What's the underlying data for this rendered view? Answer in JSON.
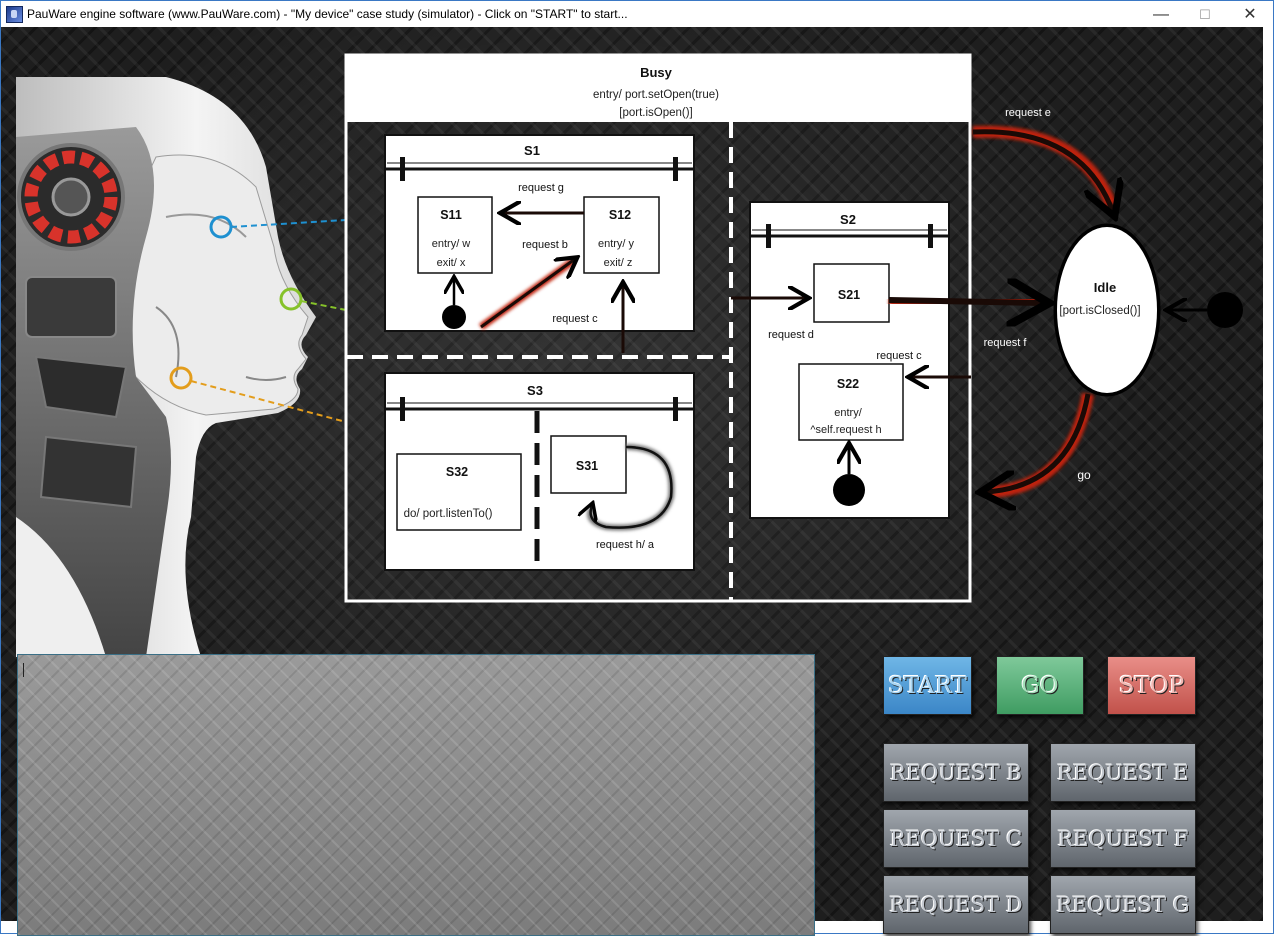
{
  "window": {
    "title": "PauWare engine software (www.PauWare.com) - \"My device\" case study (simulator) - Click on \"START\" to start...",
    "min_glyph": "—",
    "max_glyph": "☐",
    "close_glyph": "✕"
  },
  "diagram": {
    "busy": {
      "name": "Busy",
      "entry": "entry/ port.setOpen(true)",
      "guard": "[port.isOpen()]"
    },
    "s1": {
      "name": "S1"
    },
    "s11": {
      "name": "S11",
      "line1": "entry/ w",
      "line2": "exit/ x"
    },
    "s12": {
      "name": "S12",
      "line1": "entry/ y",
      "line2": "exit/ z"
    },
    "s2": {
      "name": "S2"
    },
    "s21": {
      "name": "S21"
    },
    "s22": {
      "name": "S22",
      "line1": "entry/",
      "line2": "^self.request h"
    },
    "s3": {
      "name": "S3"
    },
    "s31": {
      "name": "S31"
    },
    "s32": {
      "name": "S32",
      "line1": "do/ port.listenTo()"
    },
    "idle": {
      "name": "Idle",
      "guard": "[port.isClosed()]"
    },
    "transitions": {
      "request_g": "request g",
      "request_b": "request b",
      "request_c_s1": "request c",
      "request_d": "request d",
      "request_c_s2": "request c",
      "request_e": "request e",
      "request_f": "request f",
      "go": "go",
      "request_h_a": "request h/ a"
    }
  },
  "console": {
    "text": ""
  },
  "buttons": {
    "start": "START",
    "go": "GO",
    "stop": "STOP",
    "request_b": "REQUEST B",
    "request_c": "REQUEST C",
    "request_d": "REQUEST D",
    "request_e": "REQUEST E",
    "request_f": "REQUEST F",
    "request_g": "REQUEST G"
  },
  "colors": {
    "arrow_red": "#c0240c",
    "start_blue": "#4a9bd8",
    "go_green": "#5ab57a",
    "stop_red": "#d86a62",
    "request_gray": "#7d838a",
    "sensor_blue": "#1e90d0",
    "sensor_green": "#86c22a",
    "sensor_orange": "#e39d1c"
  }
}
